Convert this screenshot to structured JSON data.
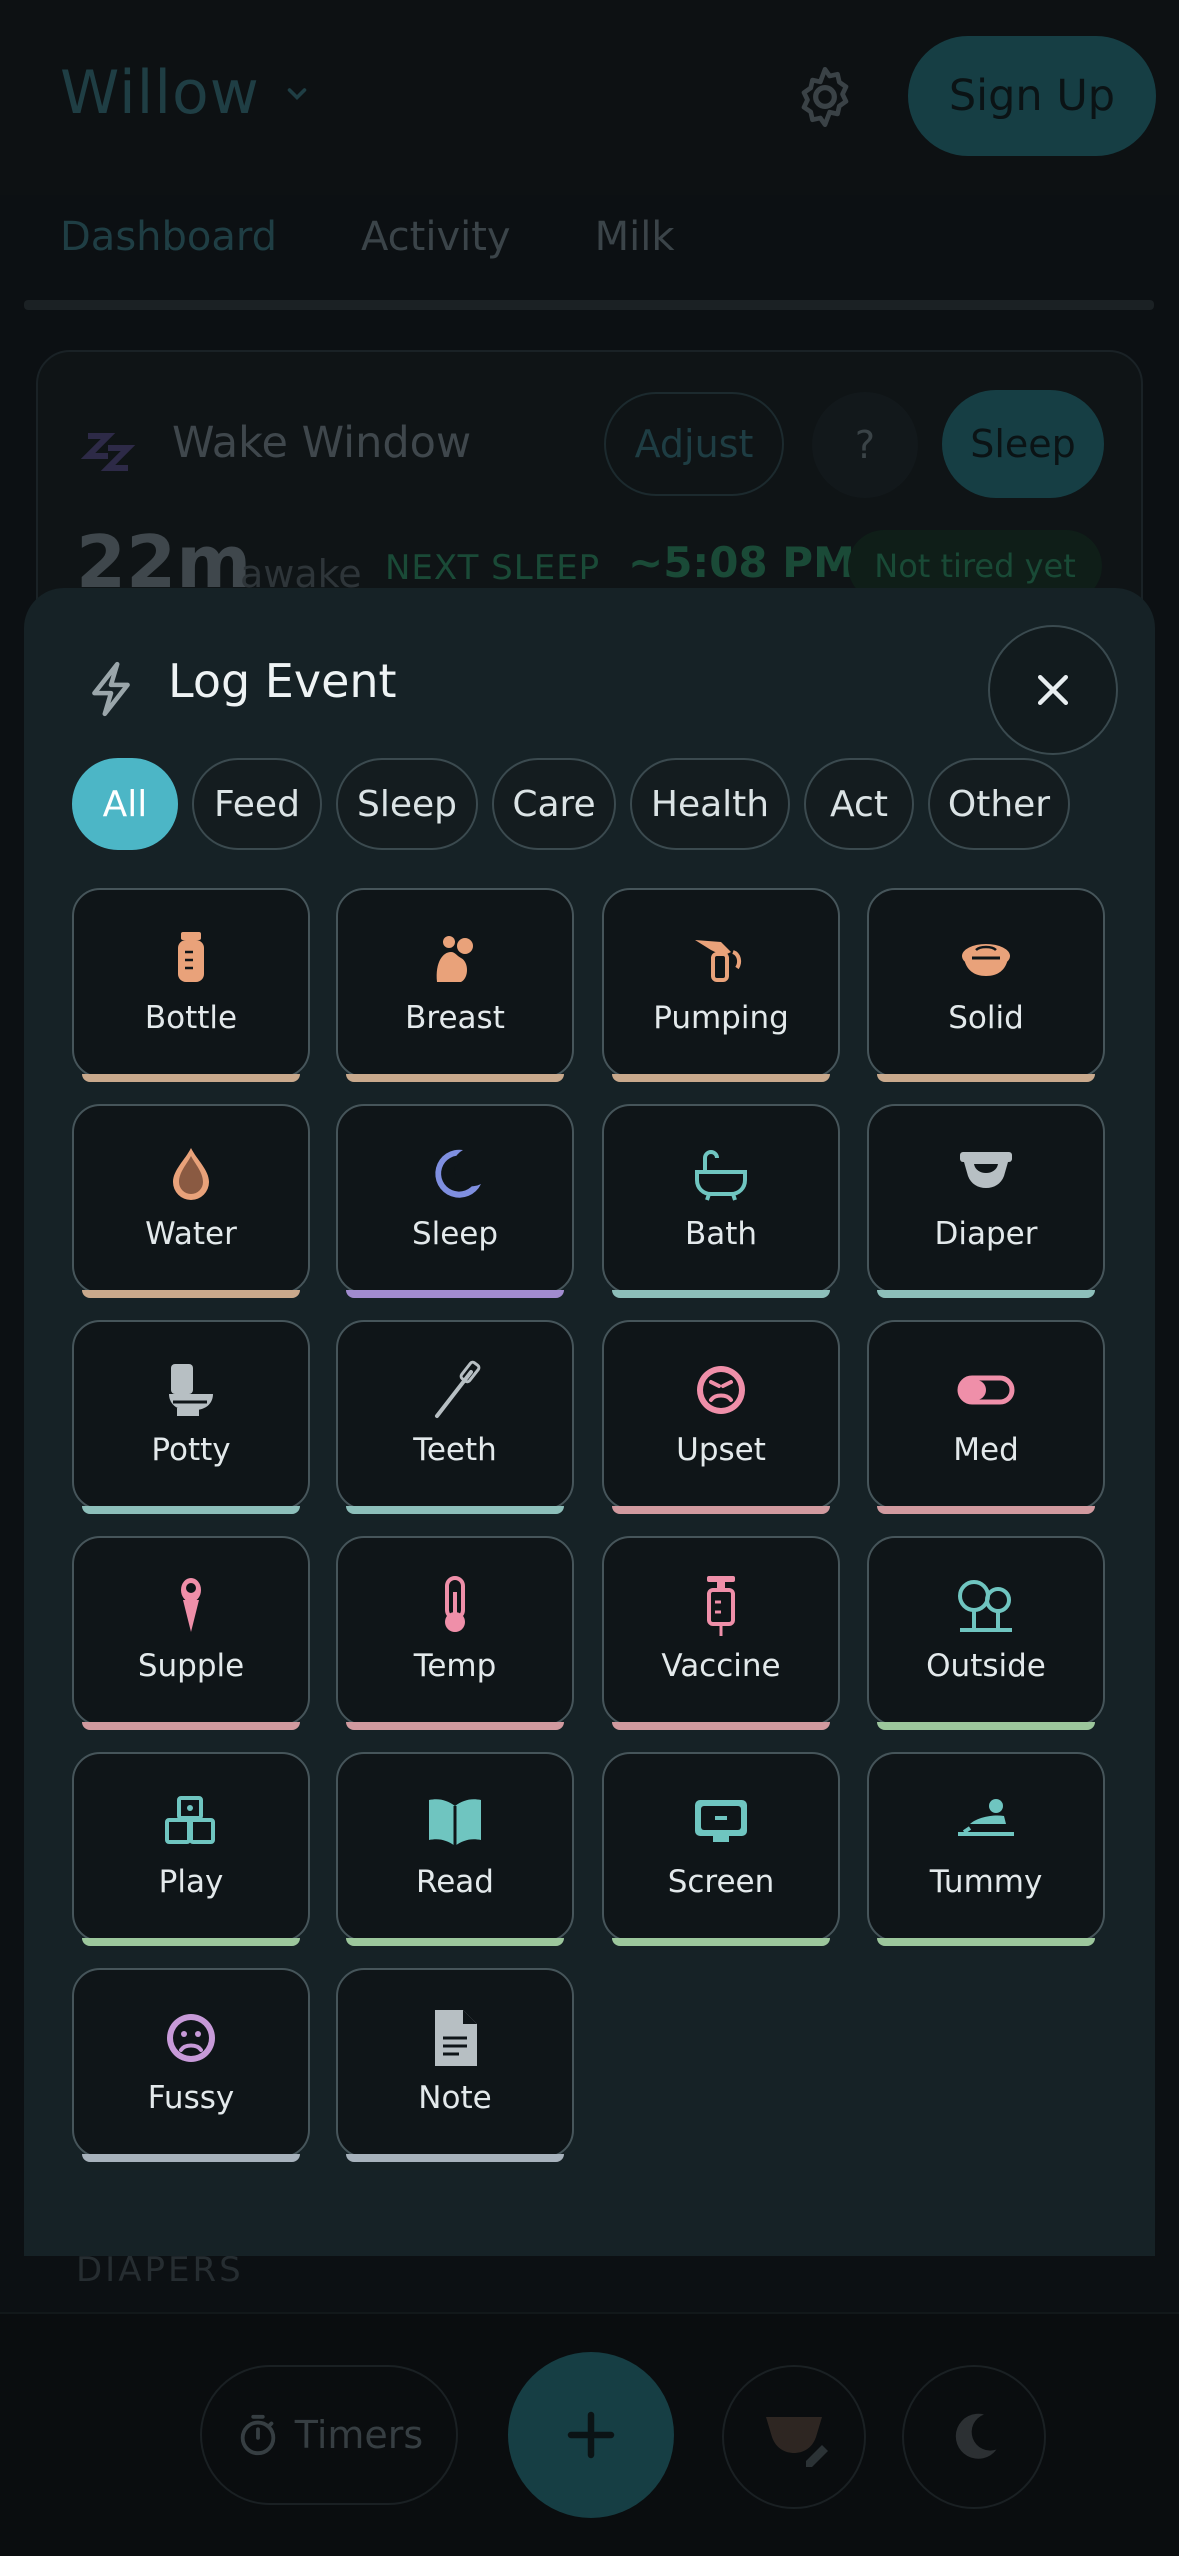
{
  "header": {
    "brand": "Willow",
    "signup_label": "Sign Up"
  },
  "tabs": [
    "Dashboard",
    "Activity",
    "Milk"
  ],
  "wake_window": {
    "title": "Wake Window",
    "adjust_label": "Adjust",
    "help_label": "?",
    "sleep_label": "Sleep",
    "awake_value": "22m",
    "awake_label": "awake",
    "next_sleep_label": "NEXT SLEEP",
    "next_sleep_time": "~5:08 PM",
    "status": "Not tired yet"
  },
  "section_diapers": "DIAPERS",
  "bottom_bar": {
    "timers_label": "Timers"
  },
  "modal": {
    "title": "Log Event",
    "filters": [
      "All",
      "Feed",
      "Sleep",
      "Care",
      "Health",
      "Act",
      "Other"
    ],
    "active_filter": "All",
    "events": [
      {
        "label": "Bottle",
        "icon": "bottle-icon",
        "color": "#c9a98c"
      },
      {
        "label": "Breast",
        "icon": "breast-icon",
        "color": "#c9a98c"
      },
      {
        "label": "Pumping",
        "icon": "pump-icon",
        "color": "#c9a98c"
      },
      {
        "label": "Solid",
        "icon": "bowl-icon",
        "color": "#c9a98c"
      },
      {
        "label": "Water",
        "icon": "water-drop-icon",
        "color": "#c9a98c"
      },
      {
        "label": "Sleep",
        "icon": "moon-icon",
        "color": "#a18ccf"
      },
      {
        "label": "Bath",
        "icon": "bathtub-icon",
        "color": "#8dbfba"
      },
      {
        "label": "Diaper",
        "icon": "diaper-icon",
        "color": "#8dbfba"
      },
      {
        "label": "Potty",
        "icon": "potty-icon",
        "color": "#8dbfba"
      },
      {
        "label": "Teeth",
        "icon": "toothbrush-icon",
        "color": "#8dbfba"
      },
      {
        "label": "Upset",
        "icon": "upset-face-icon",
        "color": "#d19a9f"
      },
      {
        "label": "Med",
        "icon": "pill-icon",
        "color": "#d19a9f"
      },
      {
        "label": "Supple",
        "icon": "dropper-icon",
        "color": "#d19a9f"
      },
      {
        "label": "Temp",
        "icon": "thermometer-icon",
        "color": "#d19a9f"
      },
      {
        "label": "Vaccine",
        "icon": "syringe-icon",
        "color": "#d19a9f"
      },
      {
        "label": "Outside",
        "icon": "trees-icon",
        "color": "#9cc79c"
      },
      {
        "label": "Play",
        "icon": "blocks-icon",
        "color": "#9cc79c"
      },
      {
        "label": "Read",
        "icon": "book-icon",
        "color": "#9cc79c"
      },
      {
        "label": "Screen",
        "icon": "screen-icon",
        "color": "#9cc79c"
      },
      {
        "label": "Tummy",
        "icon": "tummy-time-icon",
        "color": "#9cc79c"
      },
      {
        "label": "Fussy",
        "icon": "fussy-face-icon",
        "color": "#a7b2bc"
      },
      {
        "label": "Note",
        "icon": "note-icon",
        "color": "#a7b2bc"
      }
    ]
  }
}
